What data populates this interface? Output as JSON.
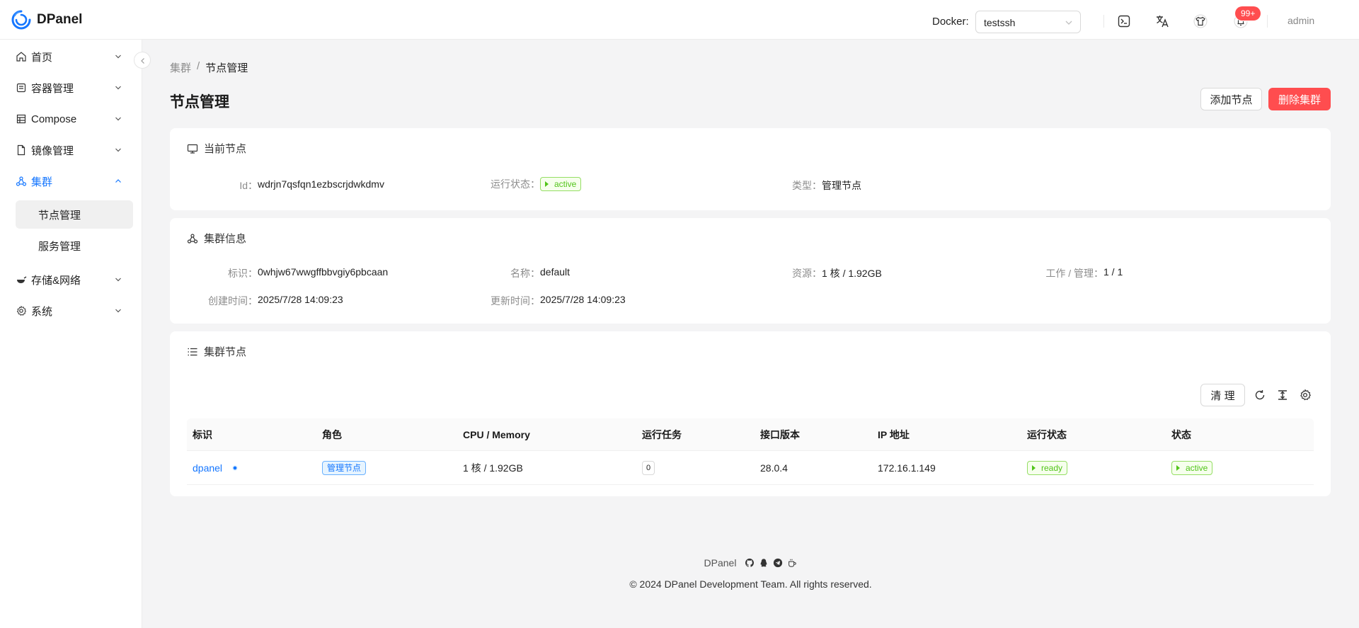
{
  "app": {
    "name": "DPanel"
  },
  "header": {
    "docker_label": "Docker:",
    "docker_value": "testssh",
    "notification_badge": "99+",
    "user": "admin",
    "icons": [
      "terminal-icon",
      "translate-icon",
      "theme-shirt-icon",
      "bell-icon"
    ]
  },
  "sidebar": {
    "items": [
      {
        "label": "首页",
        "icon": "home-icon"
      },
      {
        "label": "容器管理",
        "icon": "container-icon"
      },
      {
        "label": "Compose",
        "icon": "compose-icon"
      },
      {
        "label": "镜像管理",
        "icon": "image-file-icon"
      },
      {
        "label": "集群",
        "icon": "cluster-icon"
      },
      {
        "label": "存储&网络",
        "icon": "storage-icon"
      },
      {
        "label": "系统",
        "icon": "gear-icon"
      }
    ],
    "sub_items": [
      {
        "label": "节点管理"
      },
      {
        "label": "服务管理"
      }
    ]
  },
  "breadcrumb": {
    "parent": "集群",
    "sep": "/",
    "current": "节点管理"
  },
  "page": {
    "title": "节点管理",
    "add_node": "添加节点",
    "delete_cluster": "删除集群"
  },
  "current_node": {
    "title": "当前节点",
    "id_label": "Id：",
    "id": "wdrjn7qsfqn1ezbscrjdwkdmv",
    "status_label": "运行状态：",
    "status": "active",
    "type_label": "类型：",
    "type": "管理节点"
  },
  "cluster_info": {
    "title": "集群信息",
    "id_label": "标识：",
    "id": "0whjw67wwgffbbvgiy6pbcaan",
    "name_label": "名称：",
    "name": "default",
    "resource_label": "资源：",
    "resource": "1 核 / 1.92GB",
    "workers_label": "工作 / 管理：",
    "workers": "1 / 1",
    "created_label": "创建时间：",
    "created": "2025/7/28 14:09:23",
    "updated_label": "更新时间：",
    "updated": "2025/7/28 14:09:23"
  },
  "cluster_nodes": {
    "title": "集群节点",
    "clean_button": "清 理",
    "columns": [
      "标识",
      "角色",
      "CPU / Memory",
      "运行任务",
      "接口版本",
      "IP 地址",
      "运行状态",
      "状态"
    ],
    "rows": [
      {
        "id": "dpanel",
        "role": "管理节点",
        "cpu_mem": "1 核 / 1.92GB",
        "tasks": "0",
        "version": "28.0.4",
        "ip": "172.16.1.149",
        "run_status": "ready",
        "status": "active"
      }
    ]
  },
  "footer": {
    "brand": "DPanel",
    "copyright": "© 2024 DPanel Development Team. All rights reserved."
  },
  "colors": {
    "accent": "#1677ff",
    "danger": "#ff4d4f",
    "success": "#52c41a"
  }
}
